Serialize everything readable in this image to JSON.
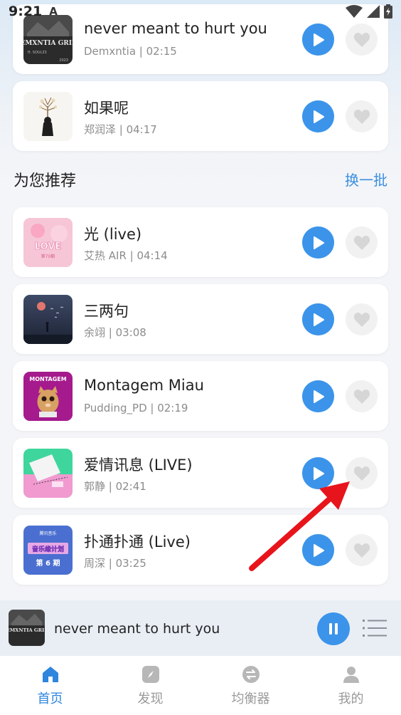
{
  "status_bar": {
    "time": "9:21",
    "notification_letter": "A"
  },
  "top_songs": [
    {
      "title": "never meant to hurt you",
      "subtitle": "Demxntia | 02:15",
      "cover_text": "DEMXNTIA GRIEF",
      "cover_tag": "ft. SOUL33",
      "cover_year": "2023"
    },
    {
      "title": "如果呢",
      "subtitle": "郑润泽 | 04:17"
    }
  ],
  "recommend": {
    "title": "为您推荐",
    "refresh_label": "换一批"
  },
  "recommend_songs": [
    {
      "title": "光 (live)",
      "subtitle": "艾热 AIR | 04:14",
      "cover_text": "LOVE",
      "cover_tag": "第70期"
    },
    {
      "title": "三两句",
      "subtitle": "余翊 | 03:08"
    },
    {
      "title": "Montagem Miau",
      "subtitle": "Pudding_PD | 02:19",
      "cover_text": "MONTAGEM"
    },
    {
      "title": "爱情讯息 (LIVE)",
      "subtitle": "郭静 | 02:41"
    },
    {
      "title": "扑通扑通 (Live)",
      "subtitle": "周深 | 03:25",
      "cover_text": "音乐缘计划",
      "cover_tag": "第 6 期",
      "cover_top": "腾讯音乐"
    }
  ],
  "mini_player": {
    "title": "never meant to hurt you"
  },
  "tabs": [
    {
      "label": "首页",
      "icon": "home-icon",
      "active": true
    },
    {
      "label": "发现",
      "icon": "compass-icon",
      "active": false
    },
    {
      "label": "均衡器",
      "icon": "equalizer-icon",
      "active": false
    },
    {
      "label": "我的",
      "icon": "user-icon",
      "active": false
    }
  ],
  "colors": {
    "accent": "#3b94ea",
    "tab_active": "#2e86de",
    "annotation_arrow": "#e8141c"
  }
}
